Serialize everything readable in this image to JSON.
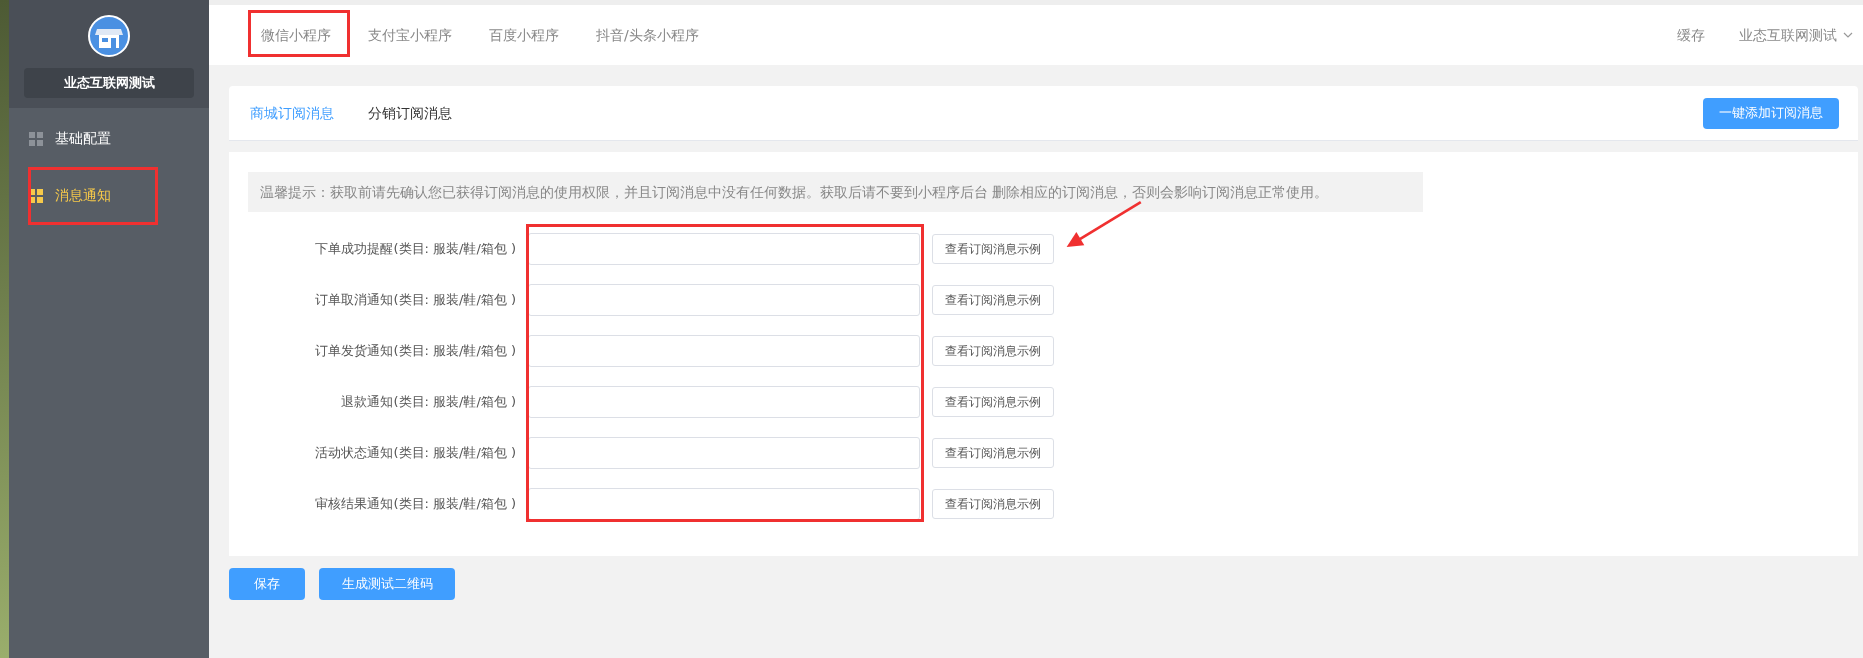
{
  "sidebar": {
    "shop_name": "业态互联网测试",
    "items": [
      {
        "label": "基础配置",
        "selected": false
      },
      {
        "label": "消息通知",
        "selected": true
      }
    ]
  },
  "platform_tabs": [
    {
      "label": "微信小程序"
    },
    {
      "label": "支付宝小程序"
    },
    {
      "label": "百度小程序"
    },
    {
      "label": "抖音/头条小程序"
    }
  ],
  "header_right": {
    "cache": "缓存",
    "account": "业态互联网测试"
  },
  "message_tabs": [
    {
      "label": "商城订阅消息",
      "selected": true
    },
    {
      "label": "分销订阅消息",
      "selected": false
    }
  ],
  "add_button": "一键添加订阅消息",
  "tip": "温馨提示：获取前请先确认您已获得订阅消息的使用权限，并且订阅消息中没有任何数据。获取后请不要到小程序后台 删除相应的订阅消息，否则会影响订阅消息正常使用。",
  "rows": [
    {
      "label": "下单成功提醒(类目: 服装/鞋/箱包 )",
      "button": "查看订阅消息示例"
    },
    {
      "label": "订单取消通知(类目: 服装/鞋/箱包 )",
      "button": "查看订阅消息示例"
    },
    {
      "label": "订单发货通知(类目: 服装/鞋/箱包 )",
      "button": "查看订阅消息示例"
    },
    {
      "label": "退款通知(类目: 服装/鞋/箱包 )",
      "button": "查看订阅消息示例"
    },
    {
      "label": "活动状态通知(类目: 服装/鞋/箱包 )",
      "button": "查看订阅消息示例"
    },
    {
      "label": "审核结果通知(类目: 服装/鞋/箱包 )",
      "button": "查看订阅消息示例"
    }
  ],
  "footer_buttons": [
    "保存",
    "生成测试二维码"
  ]
}
